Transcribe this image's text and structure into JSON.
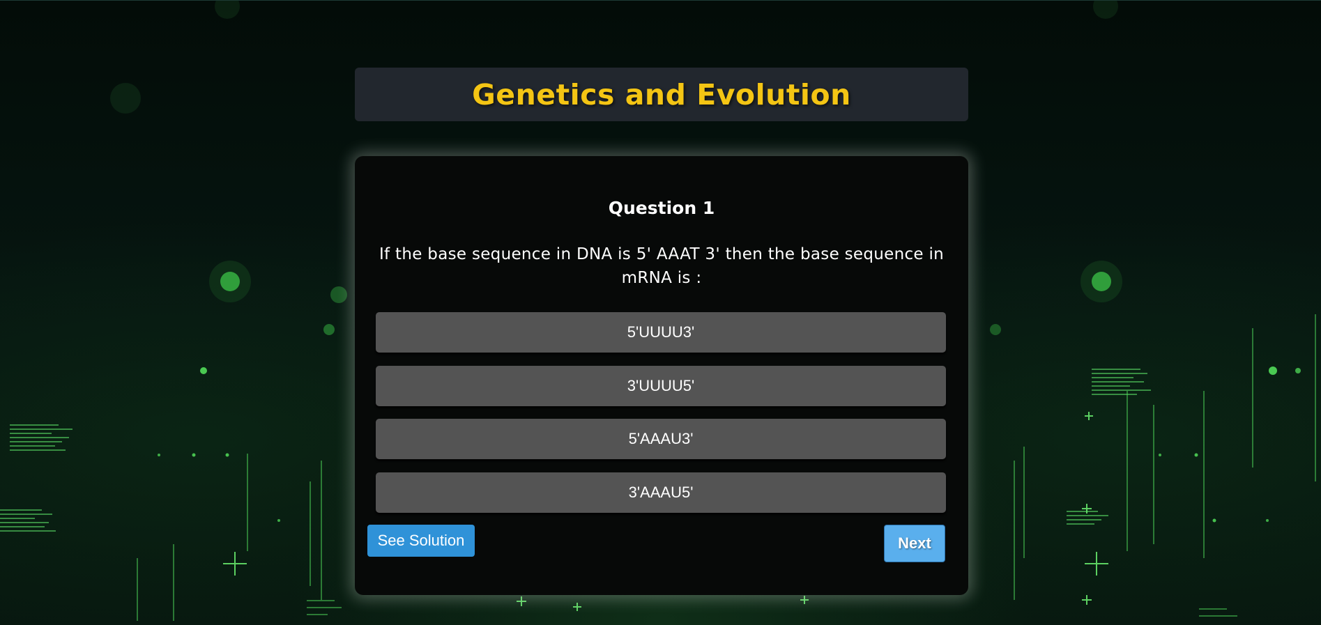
{
  "quiz": {
    "title": "Genetics and Evolution",
    "question_number": "Question 1",
    "question_text": "If the base sequence in DNA is 5' AAAT 3' then the base sequence in mRNA is :",
    "options": [
      {
        "label": "5'UUUU3'"
      },
      {
        "label": "3'UUUU5'"
      },
      {
        "label": "5'AAAU3'"
      },
      {
        "label": "3'AAAU5'"
      }
    ],
    "see_solution_label": "See Solution",
    "next_label": "Next"
  },
  "colors": {
    "title": "#f4c514",
    "title_bar_bg": "#22272e",
    "card_bg": "#070908",
    "option_bg": "#545454",
    "see_solution_bg": "#2f92d8",
    "next_bg": "#5aafed",
    "glow": "#5fe86a"
  }
}
